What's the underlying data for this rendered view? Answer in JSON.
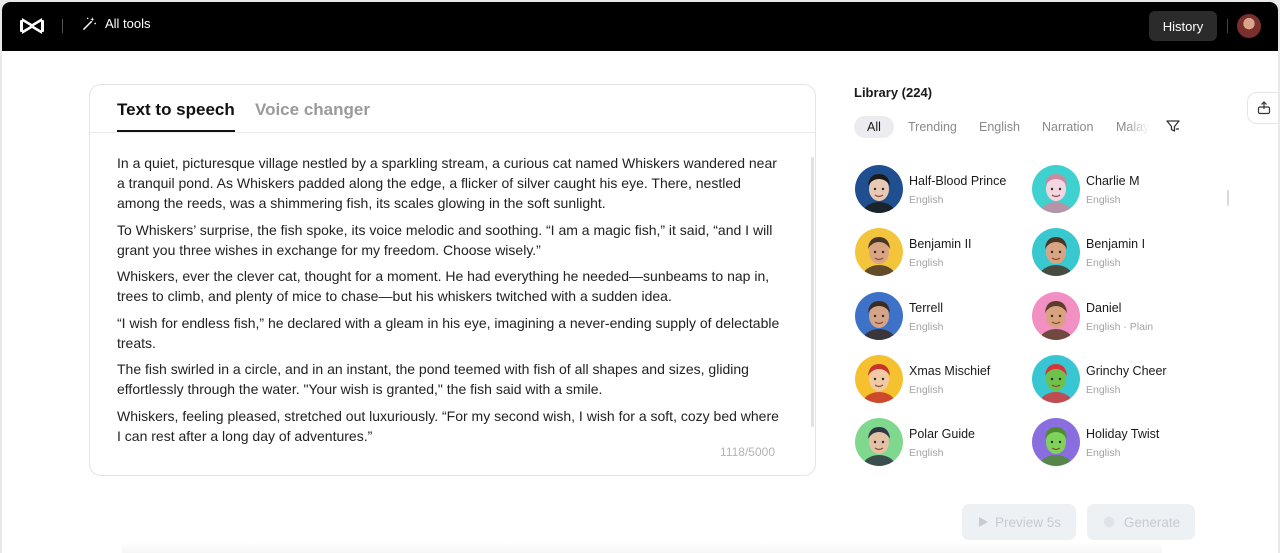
{
  "topbar": {
    "all_tools_label": "All tools",
    "history_label": "History"
  },
  "editor": {
    "tabs": [
      {
        "label": "Text to speech",
        "active": true
      },
      {
        "label": "Voice changer",
        "active": false
      }
    ],
    "paragraphs": [
      "In a quiet, picturesque village nestled by a sparkling stream, a curious cat named Whiskers wandered near a tranquil pond. As Whiskers padded along the edge, a flicker of silver caught his eye. There, nestled among the reeds, was a shimmering fish, its scales glowing in the soft sunlight.",
      "To Whiskers’ surprise, the fish spoke, its voice melodic and soothing. “I am a magic fish,” it said, “and I will grant you three wishes in exchange for my freedom. Choose wisely.”",
      "Whiskers, ever the clever cat, thought for a moment. He had everything he needed—sunbeams to nap in, trees to climb, and plenty of mice to chase—but his whiskers twitched with a sudden idea.",
      "“I wish for endless fish,” he declared with a gleam in his eye, imagining a never-ending supply of delectable treats.",
      "The fish swirled in a circle, and in an instant, the pond teemed with fish of all shapes and sizes, gliding effortlessly through the water. \"Your wish is granted,\" the fish said with a smile.",
      "Whiskers, feeling pleased, stretched out luxuriously. “For my second wish, I wish for a soft, cozy bed where I can rest after a long day of adventures.”"
    ],
    "char_count": "1118/5000"
  },
  "library": {
    "title": "Library (224)",
    "filters": [
      {
        "label": "All",
        "active": true
      },
      {
        "label": "Trending",
        "active": false
      },
      {
        "label": "English",
        "active": false
      },
      {
        "label": "Narration",
        "active": false
      },
      {
        "label": "Malay",
        "active": false
      }
    ],
    "voices": [
      {
        "name": "Half-Blood Prince",
        "lang": "English",
        "bg": "#1f4f8f",
        "face": "#e8c9b4",
        "hair": "#1b1b1b"
      },
      {
        "name": "Charlie M",
        "lang": "English",
        "bg": "#3fd1cf",
        "face": "#f4d6e3",
        "hair": "#c98aa0"
      },
      {
        "name": "Benjamin II",
        "lang": "English",
        "bg": "#f2c53c",
        "face": "#d9a482",
        "hair": "#4a3627"
      },
      {
        "name": "Benjamin I",
        "lang": "English",
        "bg": "#39c7d0",
        "face": "#d9a482",
        "hair": "#4a3627"
      },
      {
        "name": "Terrell",
        "lang": "English",
        "bg": "#3d72c8",
        "face": "#d3a487",
        "hair": "#3b2c22"
      },
      {
        "name": "Daniel",
        "lang": "English · Plain",
        "bg": "#f28fc3",
        "face": "#d9a27f",
        "hair": "#5a3c28"
      },
      {
        "name": "Xmas Mischief",
        "lang": "English",
        "bg": "#f6c12e",
        "face": "#f0c9a5",
        "hair": "#c6342b"
      },
      {
        "name": "Grinchy Cheer",
        "lang": "English",
        "bg": "#38c6d2",
        "face": "#6ec24a",
        "hair": "#d8353a"
      },
      {
        "name": "Polar Guide",
        "lang": "English",
        "bg": "#7fd88e",
        "face": "#e4c0a6",
        "hair": "#2e3742"
      },
      {
        "name": "Holiday Twist",
        "lang": "English",
        "bg": "#8a6ee0",
        "face": "#7fd35a",
        "hair": "#4c8b2f"
      }
    ]
  },
  "actions": {
    "preview_label": "Preview 5s",
    "generate_label": "Generate"
  }
}
